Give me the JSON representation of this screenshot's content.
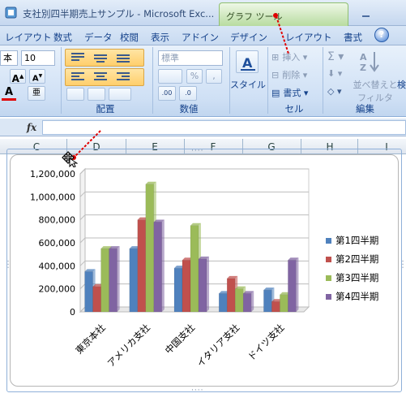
{
  "window": {
    "title": "支社別四半期売上サンプル - Microsoft Exc...",
    "context_tab": "グラフ ツール"
  },
  "tabs": [
    "レイアウト",
    "数式",
    "データ",
    "校閲",
    "表示",
    "アドイン",
    "デザイン",
    "レイアウト",
    "書式"
  ],
  "ribbon": {
    "font_name": "本",
    "font_size": "10",
    "number_format": "標準",
    "groups": {
      "alignment": "配置",
      "number": "数値",
      "cells": "セル",
      "editing": "編集"
    },
    "style_label": "スタイル",
    "insert_label": "挿入",
    "delete_label": "削除",
    "format_label": "書式",
    "sort_label_1": "並べ替えと",
    "sort_label_2": "フィルタ",
    "find_label": "検"
  },
  "formula_bar": {
    "fx": "fx",
    "value": ""
  },
  "columns": [
    "C",
    "D",
    "E",
    "F",
    "G",
    "H",
    "I"
  ],
  "colors": {
    "series": [
      "#4f81bd",
      "#c0504d",
      "#9bbb59",
      "#8064a2"
    ],
    "context_tab": "#b8dca0",
    "annotation": "#e00000"
  },
  "chart_data": {
    "type": "bar",
    "categories": [
      "東京本社",
      "アメリカ支社",
      "中国支社",
      "イタリア支社",
      "ドイツ支社"
    ],
    "series": [
      {
        "name": "第1四半期",
        "values": [
          350000,
          550000,
          380000,
          160000,
          190000
        ]
      },
      {
        "name": "第2四半期",
        "values": [
          220000,
          800000,
          450000,
          290000,
          90000
        ]
      },
      {
        "name": "第3四半期",
        "values": [
          550000,
          1110000,
          750000,
          200000,
          150000
        ]
      },
      {
        "name": "第4四半期",
        "values": [
          550000,
          780000,
          460000,
          160000,
          450000
        ]
      }
    ],
    "ylim": [
      0,
      1200000
    ],
    "yticks": [
      "0",
      "200,000",
      "400,000",
      "600,000",
      "800,000",
      "1,000,000",
      "1,200,000"
    ],
    "grid": true,
    "legend": "right"
  }
}
